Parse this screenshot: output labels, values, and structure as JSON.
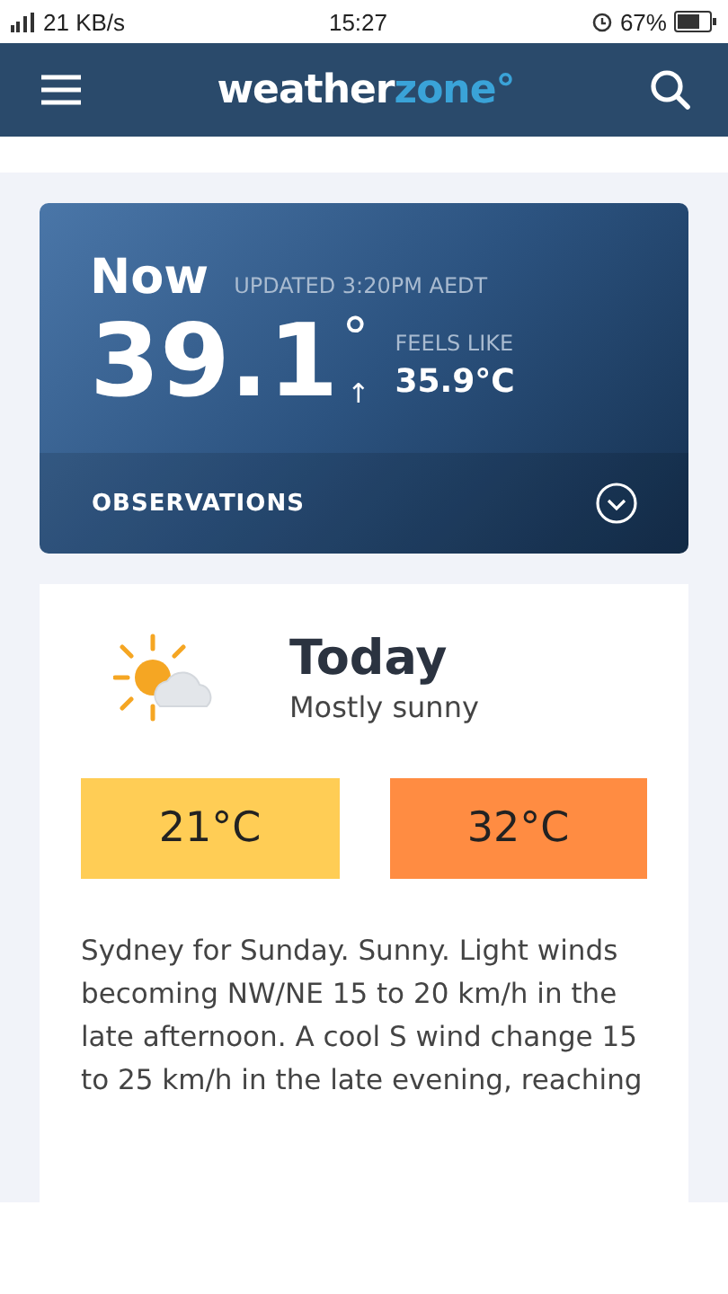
{
  "status_bar": {
    "speed": "21 KB/s",
    "time": "15:27",
    "battery": "67%"
  },
  "header": {
    "logo": {
      "primary": "weather",
      "accent": "zone°"
    }
  },
  "now": {
    "title": "Now",
    "updated": "UPDATED 3:20PM AEDT",
    "temperature": "39.1",
    "degree": "°",
    "trend": "↑",
    "feels_like_label": "FEELS LIKE",
    "feels_like": "35.9°C",
    "observations": {
      "label": "OBSERVATIONS",
      "expanded": false
    }
  },
  "today": {
    "title": "Today",
    "summary": "Mostly sunny",
    "temps": [
      {
        "value": "21°C",
        "color": "#ffcd55"
      },
      {
        "value": "32°C",
        "color": "#ff8c42"
      }
    ],
    "description": "Sydney for Sunday. Sunny. Light winds becoming NW/NE 15 to 20 km/h in the late afternoon. A cool S wind change 15 to 25 km/h in the late evening, reaching"
  }
}
